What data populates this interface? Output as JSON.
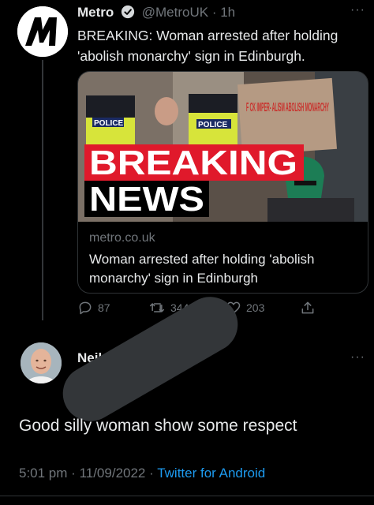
{
  "tweet": {
    "author_name": "Metro",
    "handle": "@MetroUK",
    "time": "· 1h",
    "text": "BREAKING: Woman arrested after holding 'abolish monarchy' sign in Edinburgh.",
    "more": "···",
    "card": {
      "image_text": {
        "police_left": "POLICE",
        "police_right": "POLICE",
        "sign": "F CK IMPER- ALISM ABOLISH MONARCHY",
        "breaking": "BREAKING",
        "news": "NEWS"
      },
      "domain": "metro.co.uk",
      "title": "Woman arrested after holding 'abolish monarchy' sign in Edinburgh"
    },
    "actions": {
      "replies": "87",
      "retweets": "344",
      "likes": "203"
    }
  },
  "reply": {
    "author_name": "Neil L",
    "more": "···",
    "text": "Good silly woman show some respect",
    "time": "5:01 pm",
    "date": "11/09/2022",
    "client": "Twitter for Android"
  },
  "colors": {
    "background": "#000000",
    "text": "#e7e9ea",
    "muted": "#71767b",
    "link": "#1d9bf0",
    "breaking_bg": "#e0192b"
  }
}
